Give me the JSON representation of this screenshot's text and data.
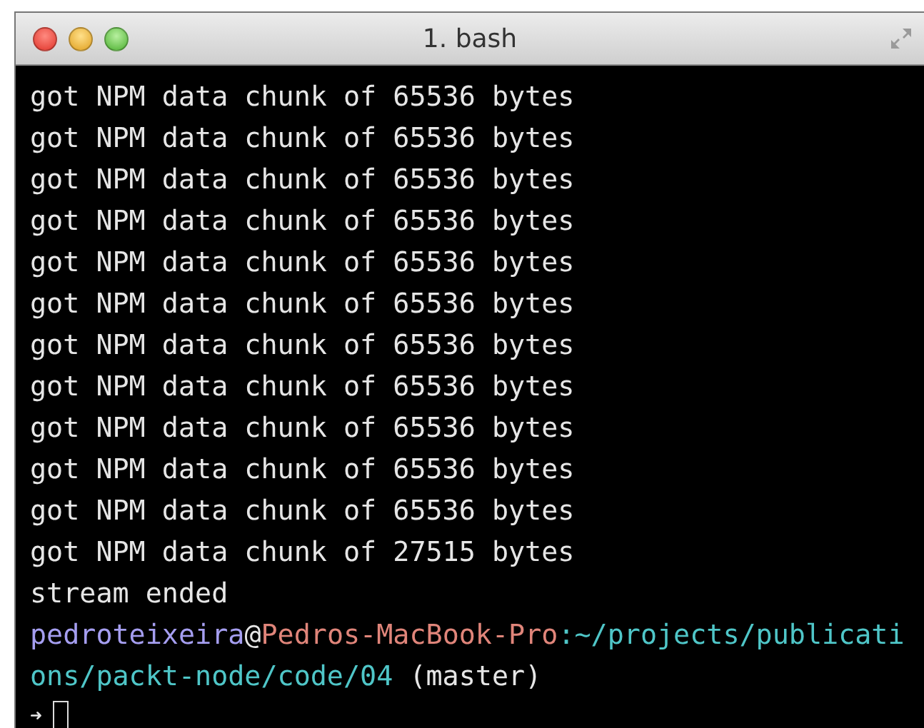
{
  "window": {
    "title": "1. bash"
  },
  "lines": [
    {
      "segments": [
        {
          "text": "got NPM data chunk of 65536 bytes",
          "color": "#e6e6e6"
        }
      ]
    },
    {
      "segments": [
        {
          "text": "got NPM data chunk of 65536 bytes",
          "color": "#e6e6e6"
        }
      ]
    },
    {
      "segments": [
        {
          "text": "got NPM data chunk of 65536 bytes",
          "color": "#e6e6e6"
        }
      ]
    },
    {
      "segments": [
        {
          "text": "got NPM data chunk of 65536 bytes",
          "color": "#e6e6e6"
        }
      ]
    },
    {
      "segments": [
        {
          "text": "got NPM data chunk of 65536 bytes",
          "color": "#e6e6e6"
        }
      ]
    },
    {
      "segments": [
        {
          "text": "got NPM data chunk of 65536 bytes",
          "color": "#e6e6e6"
        }
      ]
    },
    {
      "segments": [
        {
          "text": "got NPM data chunk of 65536 bytes",
          "color": "#e6e6e6"
        }
      ]
    },
    {
      "segments": [
        {
          "text": "got NPM data chunk of 65536 bytes",
          "color": "#e6e6e6"
        }
      ]
    },
    {
      "segments": [
        {
          "text": "got NPM data chunk of 65536 bytes",
          "color": "#e6e6e6"
        }
      ]
    },
    {
      "segments": [
        {
          "text": "got NPM data chunk of 65536 bytes",
          "color": "#e6e6e6"
        }
      ]
    },
    {
      "segments": [
        {
          "text": "got NPM data chunk of 65536 bytes",
          "color": "#e6e6e6"
        }
      ]
    },
    {
      "segments": [
        {
          "text": "got NPM data chunk of 27515 bytes",
          "color": "#e6e6e6"
        }
      ]
    },
    {
      "segments": [
        {
          "text": "stream ended",
          "color": "#e6e6e6"
        }
      ]
    },
    {
      "segments": [
        {
          "text": "pedroteixeira",
          "color": "#a59ef0"
        },
        {
          "text": "@",
          "color": "#e6e6e6"
        },
        {
          "text": "Pedros-MacBook-Pro",
          "color": "#e0857a"
        },
        {
          "text": ":~/projects/publicati",
          "color": "#4fc6c8"
        }
      ]
    },
    {
      "segments": [
        {
          "text": "ons/packt-node/code/04",
          "color": "#4fc6c8"
        },
        {
          "text": " (master)",
          "color": "#e6e6e6"
        }
      ]
    }
  ],
  "prompt": {
    "symbol": "➜"
  }
}
